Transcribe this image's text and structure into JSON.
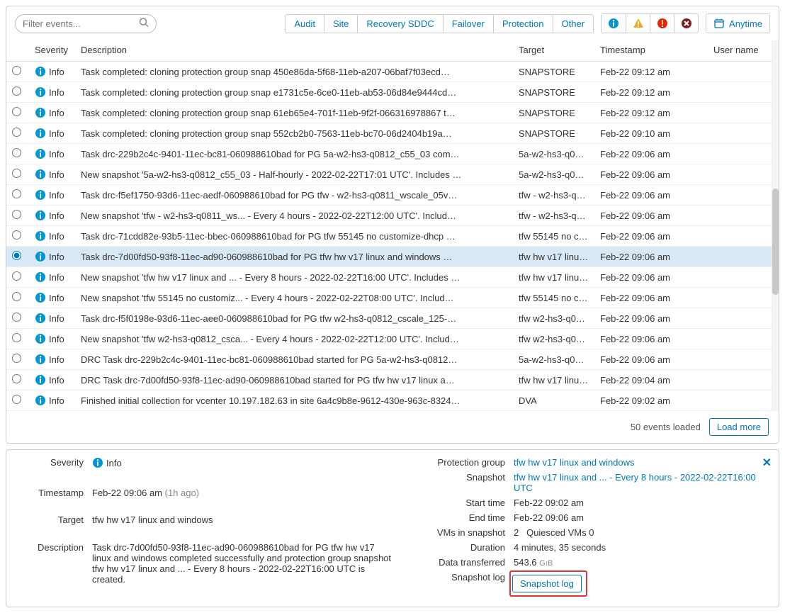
{
  "toolbar": {
    "search_placeholder": "Filter events...",
    "filters": [
      "Audit",
      "Site",
      "Recovery SDDC",
      "Failover",
      "Protection",
      "Other"
    ],
    "anytime_label": "Anytime"
  },
  "columns": {
    "severity": "Severity",
    "description": "Description",
    "target": "Target",
    "timestamp": "Timestamp",
    "username": "User name"
  },
  "severity_info": "Info",
  "rows": [
    {
      "desc": "Task completed: cloning protection group snap 450e86da-5f68-11eb-a207-06baf7f03ecd…",
      "target": "SNAPSTORE",
      "ts": "Feb-22 09:12 am",
      "sel": false
    },
    {
      "desc": "Task completed: cloning protection group snap e1731c5e-6ce0-11eb-ab53-06d84e9444cd…",
      "target": "SNAPSTORE",
      "ts": "Feb-22 09:12 am",
      "sel": false
    },
    {
      "desc": "Task completed: cloning protection group snap 61eb65e4-701f-11eb-9f2f-066316978867 t…",
      "target": "SNAPSTORE",
      "ts": "Feb-22 09:12 am",
      "sel": false
    },
    {
      "desc": "Task completed: cloning protection group snap 552cb2b0-7563-11eb-bc70-06d2404b19a…",
      "target": "SNAPSTORE",
      "ts": "Feb-22 09:10 am",
      "sel": false
    },
    {
      "desc": "Task drc-229b2c4c-9401-11ec-bc81-060988610bad for PG 5a-w2-hs3-q0812_c55_03 com…",
      "target": "5a-w2-hs3-q08…",
      "ts": "Feb-22 09:06 am",
      "sel": false
    },
    {
      "desc": "New snapshot '5a-w2-hs3-q0812_c55_03 - Half-hourly - 2022-02-22T17:01 UTC'. Includes …",
      "target": "5a-w2-hs3-q08…",
      "ts": "Feb-22 09:06 am",
      "sel": false
    },
    {
      "desc": "Task drc-f5ef1750-93d6-11ec-aedf-060988610bad for PG tfw - w2-hs3-q0811_wscale_05v…",
      "target": "tfw - w2-hs3-q…",
      "ts": "Feb-22 09:06 am",
      "sel": false
    },
    {
      "desc": "New snapshot 'tfw - w2-hs3-q0811_ws... - Every 4 hours - 2022-02-22T12:00 UTC'. Includ…",
      "target": "tfw - w2-hs3-q…",
      "ts": "Feb-22 09:06 am",
      "sel": false
    },
    {
      "desc": "Task drc-71cdd82e-93b5-11ec-bbec-060988610bad for PG tfw 55145 no customize-dhcp …",
      "target": "tfw 55145 no c…",
      "ts": "Feb-22 09:06 am",
      "sel": false
    },
    {
      "desc": "Task drc-7d00fd50-93f8-11ec-ad90-060988610bad for PG tfw hw v17 linux and windows …",
      "target": "tfw hw v17 linu…",
      "ts": "Feb-22 09:06 am",
      "sel": true
    },
    {
      "desc": "New snapshot 'tfw hw v17 linux and ... - Every 8 hours - 2022-02-22T16:00 UTC'. Includes …",
      "target": "tfw hw v17 linu…",
      "ts": "Feb-22 09:06 am",
      "sel": false
    },
    {
      "desc": "New snapshot 'tfw 55145 no customiz... - Every 4 hours - 2022-02-22T08:00 UTC'. Includ…",
      "target": "tfw 55145 no c…",
      "ts": "Feb-22 09:06 am",
      "sel": false
    },
    {
      "desc": "Task drc-f5f0198e-93d6-11ec-aee0-060988610bad for PG tfw w2-hs3-q0812_cscale_125-…",
      "target": "tfw w2-hs3-q0…",
      "ts": "Feb-22 09:06 am",
      "sel": false
    },
    {
      "desc": "New snapshot 'tfw w2-hs3-q0812_csca... - Every 4 hours - 2022-02-22T12:00 UTC'. Includ…",
      "target": "tfw w2-hs3-q0…",
      "ts": "Feb-22 09:06 am",
      "sel": false
    },
    {
      "desc": "DRC Task drc-229b2c4c-9401-11ec-bc81-060988610bad started for PG 5a-w2-hs3-q0812…",
      "target": "5a-w2-hs3-q08…",
      "ts": "Feb-22 09:06 am",
      "sel": false
    },
    {
      "desc": "DRC Task drc-7d00fd50-93f8-11ec-ad90-060988610bad started for PG tfw hw v17 linux a…",
      "target": "tfw hw v17 linu…",
      "ts": "Feb-22 09:04 am",
      "sel": false
    },
    {
      "desc": "Finished initial collection for vcenter 10.197.182.63 in site 6a4c9b8e-9612-430e-963c-8324…",
      "target": "DVA",
      "ts": "Feb-22 09:02 am",
      "sel": false
    }
  ],
  "footer": {
    "loaded": "50 events loaded",
    "more": "Load more"
  },
  "details": {
    "left": {
      "severity_label": "Severity",
      "severity_value": "Info",
      "timestamp_label": "Timestamp",
      "timestamp_value": "Feb-22 09:06 am",
      "timestamp_ago": "(1h ago)",
      "target_label": "Target",
      "target_value": "tfw hw v17 linux and windows",
      "description_label": "Description",
      "description_value": "Task drc-7d00fd50-93f8-11ec-ad90-060988610bad for PG tfw hw v17 linux and windows completed successfully and protection group snapshot tfw hw v17 linux and ... - Every 8 hours - 2022-02-22T16:00 UTC is created."
    },
    "right": {
      "pg_label": "Protection group",
      "pg_value": "tfw hw v17 linux and windows",
      "snap_label": "Snapshot",
      "snap_value": "tfw hw v17 linux and ... - Every 8 hours - 2022-02-22T16:00 UTC",
      "start_label": "Start time",
      "start_value": "Feb-22 09:02 am",
      "end_label": "End time",
      "end_value": "Feb-22 09:06 am",
      "vms_label": "VMs in snapshot",
      "vms_value": "2",
      "qvms_label": "Quiesced VMs",
      "qvms_value": "0",
      "dur_label": "Duration",
      "dur_value": "4 minutes, 35 seconds",
      "data_label": "Data transferred",
      "data_value": "543.6",
      "data_unit": "GiB",
      "log_label": "Snapshot log",
      "log_btn": "Snapshot log"
    }
  }
}
